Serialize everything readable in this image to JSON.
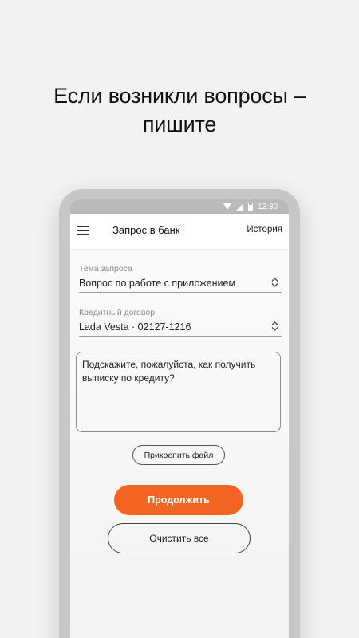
{
  "promo": {
    "title_line1": "Если возникли вопросы –",
    "title_line2": "пишите"
  },
  "status_bar": {
    "time": "12:30",
    "icons": [
      "wifi-icon",
      "signal-icon",
      "battery-icon"
    ]
  },
  "app_bar": {
    "menu_icon": "menu-icon",
    "title": "Запрос в банк",
    "history_label": "История"
  },
  "form": {
    "topic": {
      "label": "Тема запроса",
      "value": "Вопрос по работе с приложением"
    },
    "contract": {
      "label": "Кредитный договор",
      "value": "Lada Vesta · 02127-1216"
    },
    "message": {
      "value": "Подскажите, пожалуйста, как получить выписку по кредиту?"
    },
    "attach_label": "Прикрепить файл",
    "continue_label": "Продолжить",
    "clear_label": "Очистить все"
  },
  "colors": {
    "accent": "#f26522",
    "background": "#f1f2f4",
    "frame": "#c6c7c9"
  }
}
